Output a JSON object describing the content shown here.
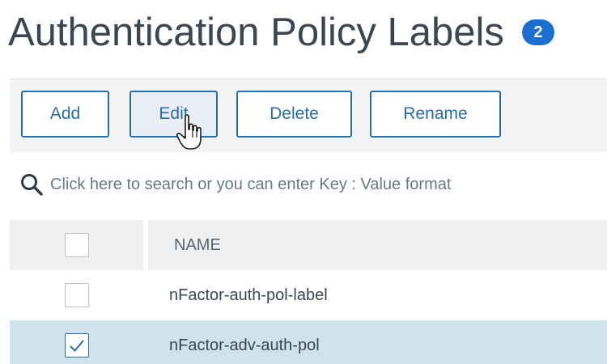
{
  "header": {
    "title": "Authentication Policy Labels",
    "count": "2"
  },
  "toolbar": {
    "add_label": "Add",
    "edit_label": "Edit",
    "delete_label": "Delete",
    "rename_label": "Rename"
  },
  "search": {
    "placeholder": "Click here to search or you can enter Key : Value format"
  },
  "table": {
    "columns": [
      "NAME"
    ],
    "rows": [
      {
        "name": "nFactor-auth-pol-label",
        "checked": false,
        "selected": false
      },
      {
        "name": "nFactor-adv-auth-pol",
        "checked": true,
        "selected": true
      }
    ]
  },
  "colors": {
    "accent": "#2a6ca3",
    "badge": "#1a6fd1",
    "selected_row": "#cfe3ef"
  },
  "icons": {
    "search": "magnifier",
    "cursor": "hand-pointer"
  }
}
